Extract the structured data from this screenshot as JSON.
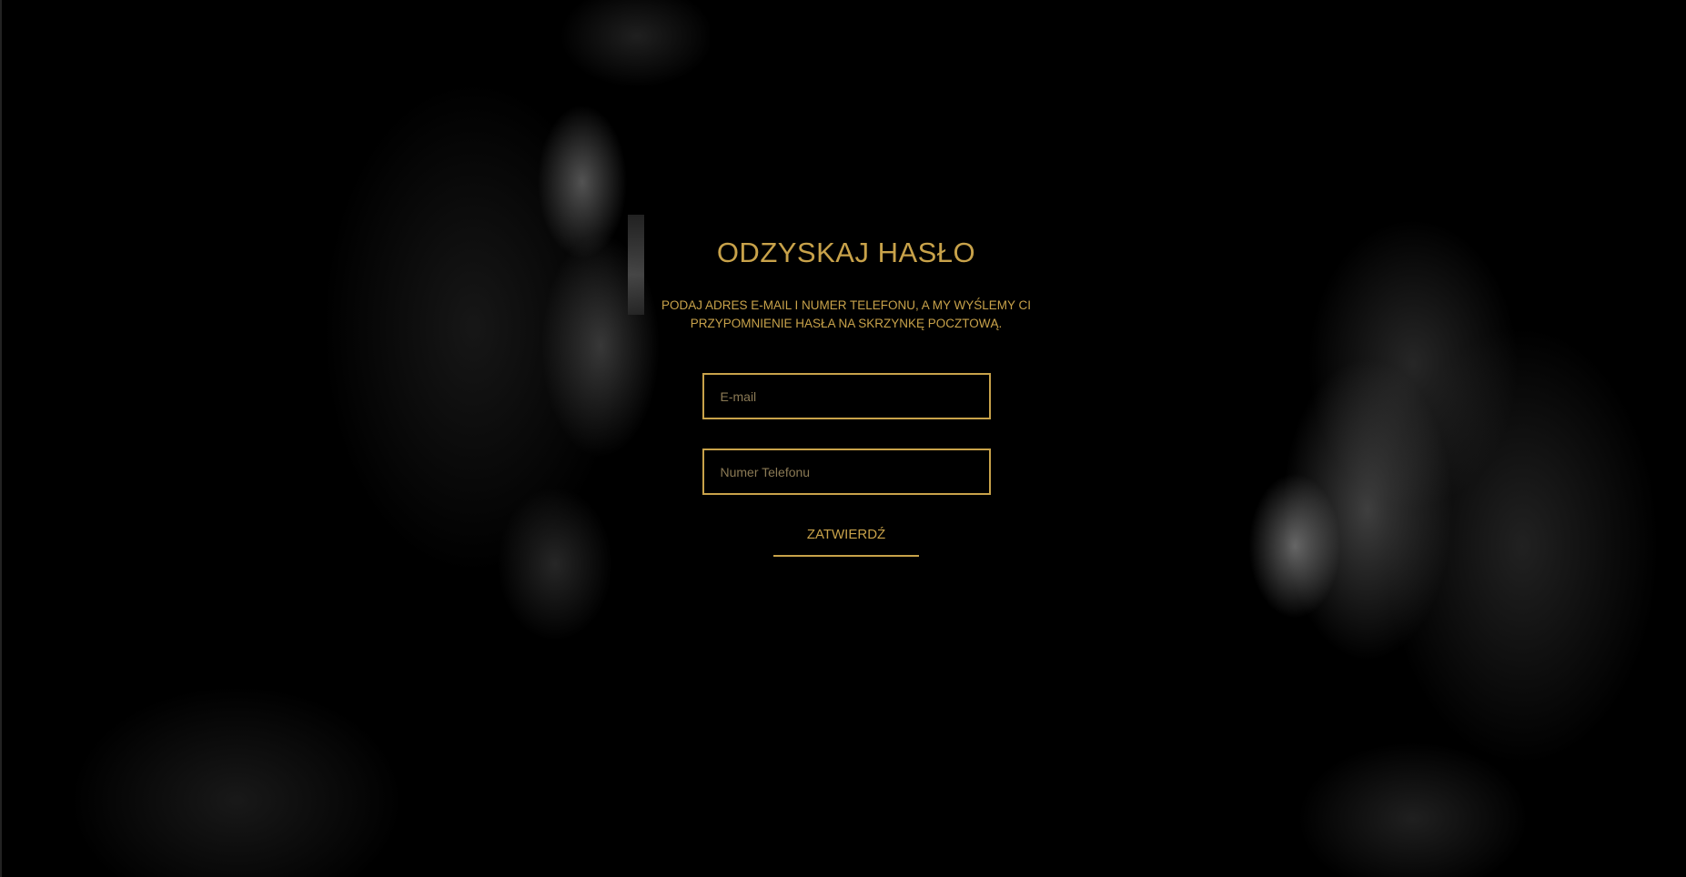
{
  "page": {
    "background_color": "#000000",
    "accent_color": "#c8a24a"
  },
  "form": {
    "title": "ODZYSKAJ HASŁO",
    "subtitle_line1": "PODAJ ADRES E-MAIL I NUMER TELEFONU, A MY WYŚLEMY CI",
    "subtitle_line2": "PRZYPOMNIENIE HASŁA NA SKRZYNKĘ POCZTOWĄ.",
    "email": {
      "value": "",
      "placeholder": "E-mail"
    },
    "phone": {
      "value": "",
      "placeholder": "Numer Telefonu"
    },
    "submit_label": "ZATWIERDŹ"
  }
}
